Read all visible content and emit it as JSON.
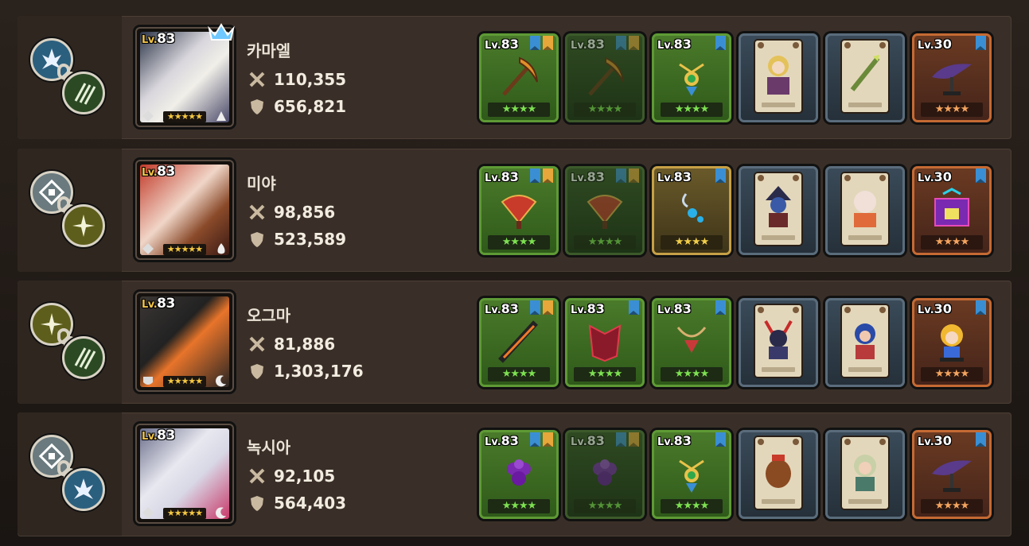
{
  "rows": [
    {
      "name": "카마엘",
      "level": "83",
      "attack": "110,355",
      "defense": "656,821",
      "equip_levels": [
        "83",
        "83",
        "83",
        "",
        "",
        "30"
      ]
    },
    {
      "name": "미야",
      "level": "83",
      "attack": "98,856",
      "defense": "523,589",
      "equip_levels": [
        "83",
        "83",
        "83",
        "",
        "",
        "30"
      ]
    },
    {
      "name": "오그마",
      "level": "83",
      "attack": "81,886",
      "defense": "1,303,176",
      "equip_levels": [
        "83",
        "83",
        "83",
        "",
        "",
        "30"
      ]
    },
    {
      "name": "녹시아",
      "level": "83",
      "attack": "92,105",
      "defense": "564,403",
      "equip_levels": [
        "83",
        "83",
        "83",
        "",
        "",
        "30"
      ]
    }
  ],
  "lv_prefix": "Lv.",
  "stars": "★★★★",
  "hero_stars": "★★★★★",
  "colors": {
    "row_bg": "#3a2f28",
    "weapon_green": "#5e9a35",
    "accessory_gold": "#c6a046",
    "card_border": "#5a6c7c",
    "costume_orange": "#c56a33"
  }
}
